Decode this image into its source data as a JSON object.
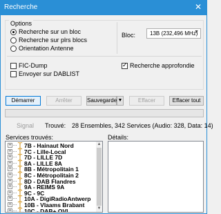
{
  "window": {
    "title": "Recherche",
    "close_glyph": "✕"
  },
  "options": {
    "group_label": "Options",
    "radios": [
      {
        "label": "Recherche sur un bloc",
        "selected": true
      },
      {
        "label": "Recherche sur plrs blocs",
        "selected": false
      },
      {
        "label": "Orientation Antenne",
        "selected": false
      }
    ],
    "bloc_label": "Bloc:",
    "bloc_value": "13B (232,496 MHz)",
    "checkboxes": {
      "fic_dump": {
        "label": "FIC-Dump",
        "checked": false
      },
      "dablist": {
        "label": "Envoyer sur DABLIST",
        "checked": false
      },
      "approfondie": {
        "label": "Recherche approfondie",
        "checked": true
      }
    }
  },
  "toolbar": {
    "demarrer": "Démarrer",
    "arreter": "Arrêter",
    "sauvegarder": "Sauvegarder",
    "effacer": "Effacer",
    "effacer_tout": "Effacer tout"
  },
  "status": {
    "signal_label": "Signal",
    "trouve_label": "Trouvé:",
    "trouve_value": "28 Ensembles, 342 Services (Audio: 328, Data: 14)"
  },
  "services": {
    "label": "Services trouvés:",
    "items": [
      "7B - Hainaut Nord",
      "7C - Lille-Local",
      "7D - LILLE 7D",
      "8A - LILLE 8A",
      "8B - Métropolitain 1",
      "8C - Métropolitain 2",
      "8D - DAB Flandres",
      "9A - REIMS 9A",
      "9C - 9C",
      "10A - DigiRadioAntwerp",
      "10B - Vlaams Brabant",
      "10C - DAB+ OVL"
    ]
  },
  "details": {
    "label": "Détails:"
  },
  "colors": {
    "titlebar": "#2a8fd6",
    "antenna": "#d9a441"
  }
}
